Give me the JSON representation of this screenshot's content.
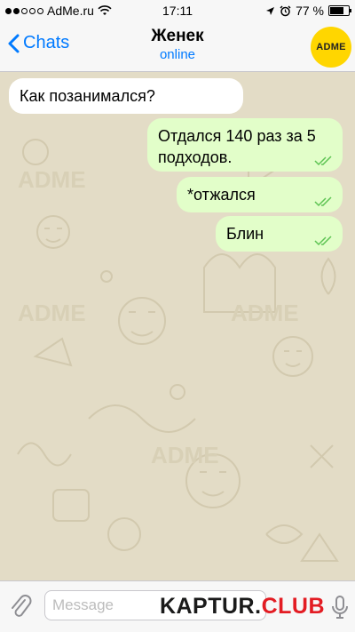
{
  "status": {
    "carrier": "AdMe.ru",
    "time": "17:11",
    "battery": "77 %",
    "battery_level": 0.77
  },
  "nav": {
    "back_label": "Chats",
    "title": "Женек",
    "subtitle": "online",
    "avatar_text": "ADME"
  },
  "messages": [
    {
      "direction": "incoming",
      "text": "Как позанимался?"
    },
    {
      "direction": "outgoing",
      "text": "Отдался 140 раз за 5 подходов."
    },
    {
      "direction": "outgoing",
      "text": "*отжался"
    },
    {
      "direction": "outgoing",
      "text": "Блин"
    }
  ],
  "input": {
    "placeholder": "Message"
  },
  "watermark": {
    "main": "KAPTUR.",
    "accent": "CLUB"
  },
  "colors": {
    "accent": "#007aff",
    "outgoing_bubble": "#e2fec9",
    "incoming_bubble": "#ffffff",
    "wallpaper": "#e3dcc6",
    "read_check": "#5dc452",
    "avatar": "#ffd600"
  }
}
